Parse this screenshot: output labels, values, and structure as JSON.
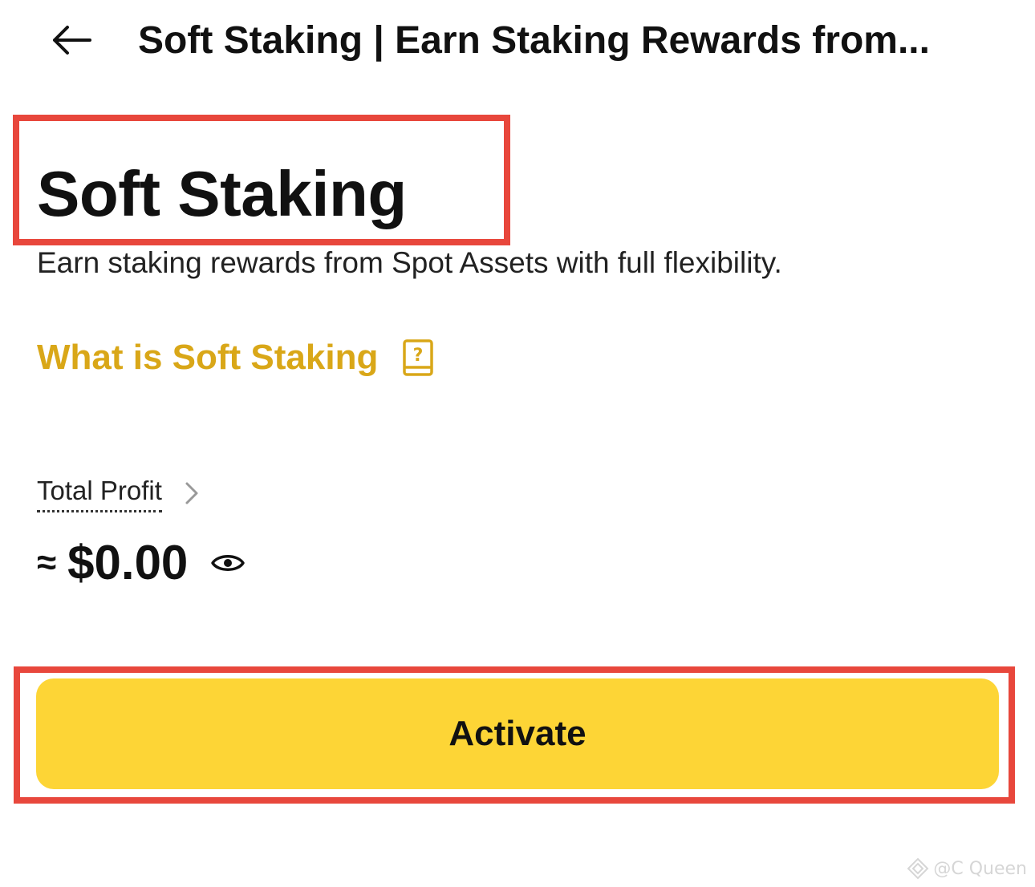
{
  "header": {
    "back_icon": "arrow-left-icon",
    "title": "Soft Staking | Earn Staking Rewards from..."
  },
  "main": {
    "page_title": "Soft Staking",
    "subtitle": "Earn staking rewards from Spot Assets with full flexibility.",
    "what_is_link": {
      "label": "What is Soft Staking",
      "icon": "help-book-icon"
    },
    "total_profit": {
      "label": "Total Profit",
      "approx_symbol": "≈",
      "value": "$0.00",
      "chevron_icon": "chevron-right-icon",
      "visibility_icon": "eye-icon"
    },
    "activate_label": "Activate"
  },
  "watermark": {
    "text": "@C Queen"
  },
  "colors": {
    "accent_gold": "#d9a718",
    "button_yellow": "#fdd536",
    "highlight_red": "#e8473c"
  }
}
